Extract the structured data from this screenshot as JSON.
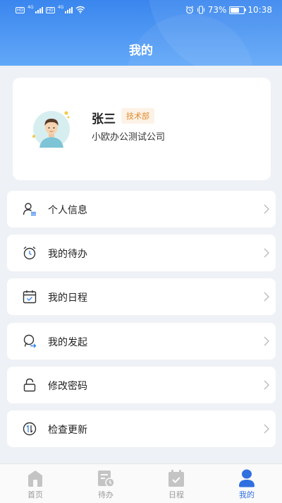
{
  "status_bar": {
    "time": "10:38",
    "battery": "73%",
    "battery_level": 0.73,
    "network_1": "4G",
    "network_2": "4G",
    "hd_1": "HD",
    "hd_2": "HD",
    "icons": [
      "alarm-icon",
      "vibrate-icon",
      "battery-icon",
      "wifi-icon",
      "signal-icon"
    ]
  },
  "header": {
    "title": "我的"
  },
  "profile": {
    "name": "张三",
    "department": "技术部",
    "company": "小欧办公测试公司"
  },
  "menu": [
    {
      "label": "个人信息",
      "icon": "person-info-icon"
    },
    {
      "label": "我的待办",
      "icon": "alarm-clock-icon"
    },
    {
      "label": "我的日程",
      "icon": "calendar-icon"
    },
    {
      "label": "我的发起",
      "icon": "user-forward-icon"
    },
    {
      "label": "修改密码",
      "icon": "lock-icon"
    },
    {
      "label": "检查更新",
      "icon": "update-icon"
    }
  ],
  "tabs": [
    {
      "label": "首页",
      "icon": "home-icon",
      "active": false
    },
    {
      "label": "待办",
      "icon": "todo-icon",
      "active": false
    },
    {
      "label": "日程",
      "icon": "schedule-icon",
      "active": false
    },
    {
      "label": "我的",
      "icon": "profile-icon",
      "active": true
    }
  ],
  "colors": {
    "primary": "#3a86ee",
    "tab_active": "#2f6fe0",
    "tab_inactive": "#9a9a9a",
    "badge_text": "#e08a2e",
    "badge_bg": "#fdf2e6"
  }
}
